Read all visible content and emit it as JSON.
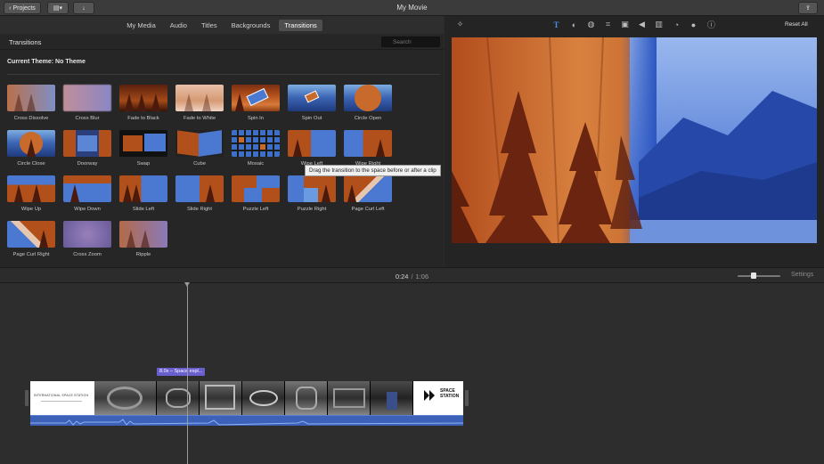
{
  "window": {
    "title": "My Movie",
    "projects_label": "Projects"
  },
  "browser_tabs": [
    {
      "label": "My Media",
      "active": false
    },
    {
      "label": "Audio",
      "active": false
    },
    {
      "label": "Titles",
      "active": false
    },
    {
      "label": "Backgrounds",
      "active": false
    },
    {
      "label": "Transitions",
      "active": true
    }
  ],
  "panel": {
    "title": "Transitions",
    "search_placeholder": "Search",
    "theme_label": "Current Theme: No Theme"
  },
  "transitions": [
    {
      "label": "Cross Dissolve"
    },
    {
      "label": "Cross Blur"
    },
    {
      "label": "Fade to Black"
    },
    {
      "label": "Fade to White"
    },
    {
      "label": "Spin In"
    },
    {
      "label": "Spin Out"
    },
    {
      "label": "Circle Open"
    },
    {
      "label": "Circle Close"
    },
    {
      "label": "Doorway"
    },
    {
      "label": "Swap"
    },
    {
      "label": "Cube"
    },
    {
      "label": "Mosaic"
    },
    {
      "label": "Wipe Left"
    },
    {
      "label": "Wipe Right"
    },
    {
      "label": "Wipe Up"
    },
    {
      "label": "Wipe Down"
    },
    {
      "label": "Slide Left"
    },
    {
      "label": "Slide Right"
    },
    {
      "label": "Puzzle Left"
    },
    {
      "label": "Puzzle Right"
    },
    {
      "label": "Page Curl Left"
    },
    {
      "label": "Page Curl Right"
    },
    {
      "label": "Cross Zoom"
    },
    {
      "label": "Ripple"
    }
  ],
  "tooltip": "Drag the transition to the space before or after a clip",
  "viewer": {
    "reset_label": "Reset All",
    "tools": [
      "magic-wand-icon",
      "text-icon",
      "color-balance-icon",
      "color-correction-icon",
      "crop-icon",
      "stabilization-icon",
      "volume-icon",
      "equalizer-icon",
      "speed-icon",
      "filter-icon",
      "info-icon"
    ]
  },
  "timeline": {
    "current_time": "0:24",
    "total_time": "1:06",
    "settings_label": "Settings",
    "clip_label": "8.0s – Space expl...",
    "title_card_text": "INTERNATIONAL SPACE STATION",
    "end_card_text": "SPACE STATION"
  },
  "colors": {
    "accent": "#4a90e2",
    "clip_label_bg": "#6a5fcf",
    "audio_track": "#3c61b8"
  }
}
